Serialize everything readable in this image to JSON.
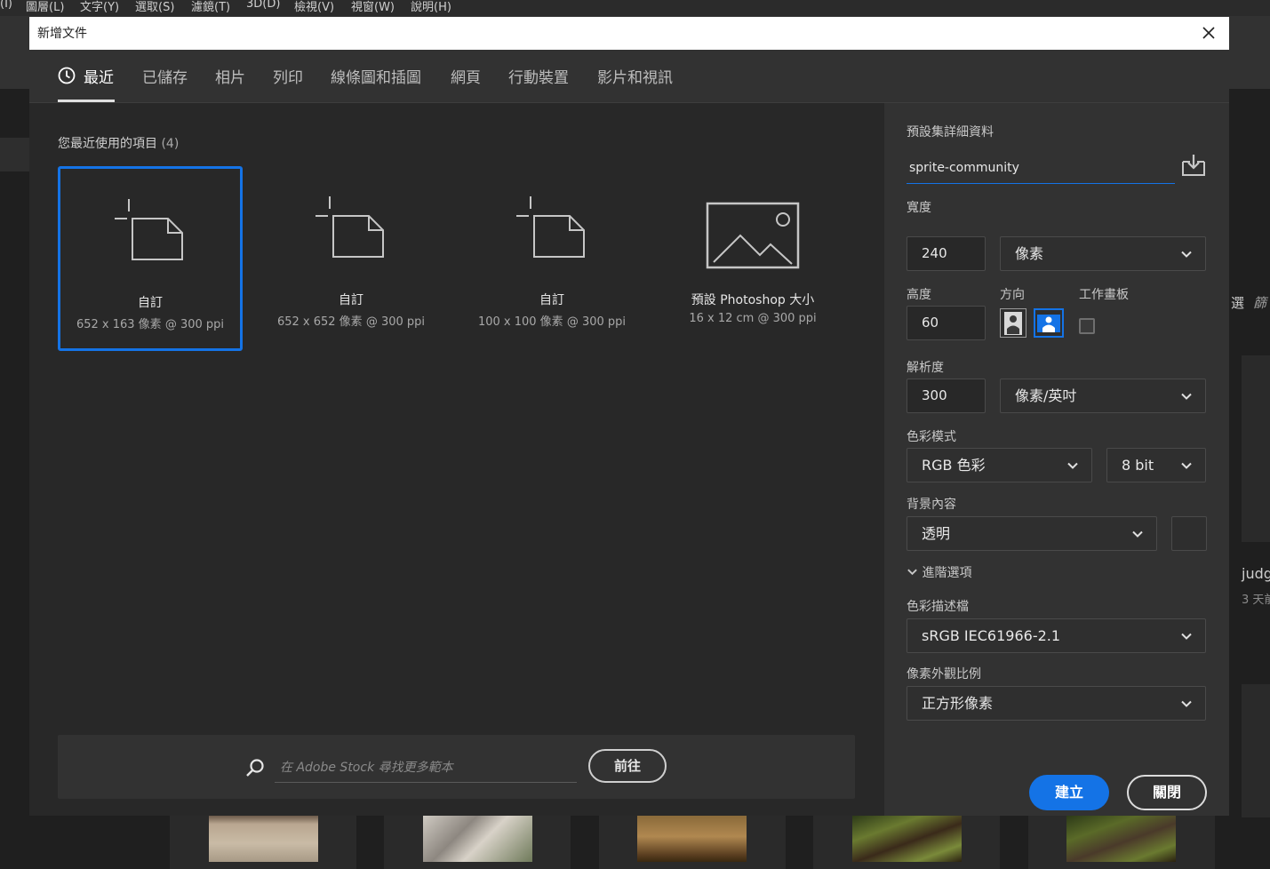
{
  "app_menu": [
    "(I)",
    "圖層(L)",
    "文字(Y)",
    "選取(S)",
    "濾鏡(T)",
    "3D(D)",
    "檢視(V)",
    "視窗(W)",
    "說明(H)"
  ],
  "background": {
    "right_items": [
      "選",
      "篩"
    ],
    "recent_file": {
      "name": "judg",
      "time": "3 天前"
    }
  },
  "dialog": {
    "title": "新增文件",
    "tabs": [
      {
        "label": "最近",
        "icon": "clock-icon",
        "active": true
      },
      {
        "label": "已儲存"
      },
      {
        "label": "相片"
      },
      {
        "label": "列印"
      },
      {
        "label": "線條圖和插圖"
      },
      {
        "label": "網頁"
      },
      {
        "label": "行動裝置"
      },
      {
        "label": "影片和視訊"
      }
    ],
    "recent": {
      "title": "您最近使用的項目",
      "count": "(4)",
      "items": [
        {
          "name": "自訂",
          "size": "652 x 163 像素 @ 300 ppi",
          "icon": "custom-document-icon",
          "selected": true
        },
        {
          "name": "自訂",
          "size": "652 x 652 像素 @ 300 ppi",
          "icon": "custom-document-icon"
        },
        {
          "name": "自訂",
          "size": "100 x 100 像素 @ 300 ppi",
          "icon": "custom-document-icon"
        },
        {
          "name": "預設 Photoshop 大小",
          "size": "16 x 12 cm @ 300 ppi",
          "icon": "image-icon"
        }
      ]
    },
    "stock": {
      "placeholder": "在 Adobe Stock 尋找更多範本",
      "go_label": "前往"
    },
    "details": {
      "title": "預設集詳細資料",
      "preset_name": "sprite-community",
      "width_label": "寬度",
      "width": "240",
      "width_unit": "像素",
      "height_label": "高度",
      "height": "60",
      "orientation_label": "方向",
      "orientation": "landscape",
      "artboard_label": "工作畫板",
      "artboard_checked": false,
      "resolution_label": "解析度",
      "resolution": "300",
      "resolution_unit": "像素/英吋",
      "color_mode_label": "色彩模式",
      "color_mode": "RGB 色彩",
      "bit_depth": "8 bit",
      "background_label": "背景內容",
      "background": "透明",
      "advanced_label": "進階選項",
      "color_profile_label": "色彩描述檔",
      "color_profile": "sRGB IEC61966-2.1",
      "pixel_aspect_label": "像素外觀比例",
      "pixel_aspect": "正方形像素",
      "create_label": "建立",
      "close_label": "關閉"
    }
  },
  "colors": {
    "accent": "#1473e6",
    "dialog_bg": "#282828",
    "panel_bg": "#323232"
  }
}
